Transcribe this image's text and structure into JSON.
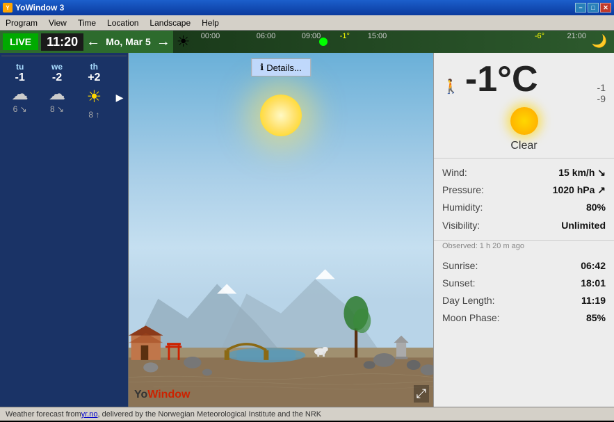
{
  "titlebar": {
    "title": "YoWindow 3",
    "min_label": "−",
    "max_label": "□",
    "close_label": "✕"
  },
  "menubar": {
    "items": [
      {
        "label": "Program"
      },
      {
        "label": "View"
      },
      {
        "label": "Time"
      },
      {
        "label": "Location"
      },
      {
        "label": "Landscape"
      },
      {
        "label": "Help"
      }
    ]
  },
  "timeline": {
    "live_label": "LIVE",
    "time": "11:20",
    "nav_left": "←",
    "nav_right": "→",
    "date": "Mo, Mar 5",
    "markers": [
      "00:00",
      "06:00",
      "09:00",
      "15:00",
      "21:00"
    ],
    "temp_left": "-1°",
    "temp_right": "-6°"
  },
  "forecast": {
    "days": [
      {
        "name": "tu",
        "temp": "-1",
        "low": "6 ↘",
        "icon": "cloud"
      },
      {
        "name": "we",
        "temp": "-2",
        "low": "8 ↘",
        "icon": "cloud"
      },
      {
        "name": "th",
        "temp": "+2",
        "low": "8 ↑",
        "icon": "sun"
      }
    ],
    "arrow": "▶"
  },
  "details_btn": "Details...",
  "weather": {
    "temp": "-1°C",
    "side_temp_top": "-1",
    "side_temp_bottom": "-9",
    "condition": "Clear",
    "wind_label": "Wind:",
    "wind_value": "15 km/h ↘",
    "pressure_label": "Pressure:",
    "pressure_value": "1020 hPa ↗",
    "humidity_label": "Humidity:",
    "humidity_value": "80%",
    "visibility_label": "Visibility:",
    "visibility_value": "Unlimited",
    "observed": "Observed:  1 h 20 m ago",
    "sunrise_label": "Sunrise:",
    "sunrise_value": "06:42",
    "sunset_label": "Sunset:",
    "sunset_value": "18:01",
    "daylength_label": "Day Length:",
    "daylength_value": "11:19",
    "moonphase_label": "Moon Phase:",
    "moonphase_value": "85%"
  },
  "statusbar": {
    "text_before": "Weather forecast from ",
    "link_text": "yr.no",
    "text_after": ", delivered by the Norwegian Meteorological Institute and the NRK"
  },
  "icons": {
    "info": "ℹ",
    "walk": "🚶",
    "sun": "☀",
    "moon": "🌙",
    "cloud": "☁",
    "expand": "⤢"
  }
}
